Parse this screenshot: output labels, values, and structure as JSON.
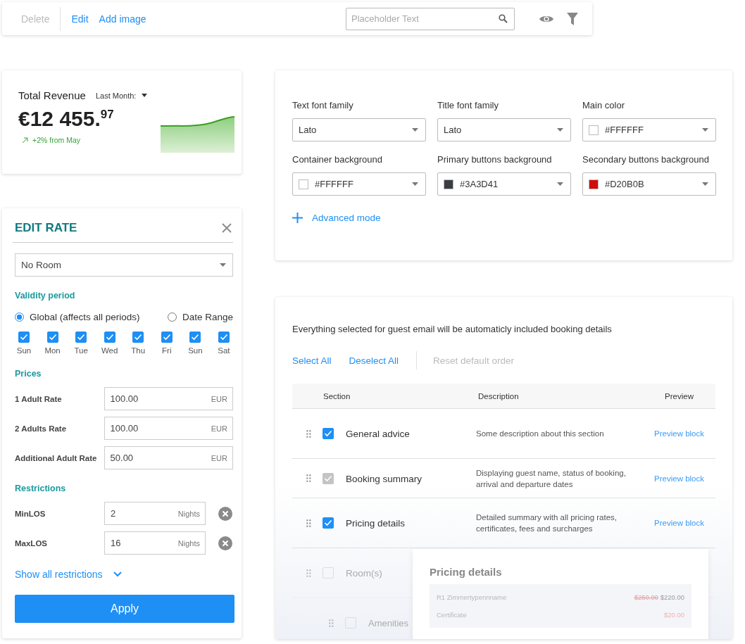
{
  "toolbar": {
    "actions": [
      {
        "label": "Delete",
        "disabled": true
      },
      {
        "label": "Edit",
        "disabled": false
      },
      {
        "label": "Add image",
        "disabled": false
      }
    ],
    "search": {
      "placeholder": "Placeholder Text"
    }
  },
  "revenue": {
    "title": "Total Revenue",
    "period": "Last Month:",
    "amount": "€12 455.$^{97}$",
    "change": "+2% from May"
  },
  "edit_rate": {
    "title": "EDIT RATE",
    "room": "No Room",
    "validity_heading": "Validity period",
    "validity_options": [
      {
        "label": "Global (affects all periods)",
        "selected": true
      },
      {
        "label": "Date Range",
        "selected": false
      }
    ],
    "days": [
      {
        "label": "Sun",
        "checked": true
      },
      {
        "label": "Mon",
        "checked": true
      },
      {
        "label": "Tue",
        "checked": true
      },
      {
        "label": "Wed",
        "checked": true
      },
      {
        "label": "Thu",
        "checked": true
      },
      {
        "label": "Fri",
        "checked": true
      },
      {
        "label": "Sun",
        "checked": true
      },
      {
        "label": "Sat",
        "checked": true
      }
    ],
    "prices_heading": "Prices",
    "prices": [
      {
        "label": "1 Adult Rate",
        "value": "100.00",
        "unit": "EUR"
      },
      {
        "label": "2 Adults Rate",
        "value": "100.00",
        "unit": "EUR"
      },
      {
        "label": "Additional Adult Rate",
        "value": "50.00",
        "unit": "EUR"
      }
    ],
    "restrictions_heading": "Restrictions",
    "restrictions": [
      {
        "label": "MinLOS",
        "value": "2",
        "unit": "Nights"
      },
      {
        "label": "MaxLOS",
        "value": "16",
        "unit": "Nights"
      }
    ],
    "show_all": "Show all restrictions",
    "apply": "Apply"
  },
  "theme_settings": {
    "fields": [
      {
        "kind": "select",
        "label": "Text font family",
        "value": "Lato"
      },
      {
        "kind": "select",
        "label": "Title font family",
        "value": "Lato"
      },
      {
        "kind": "color",
        "label": "Main color",
        "value": "#FFFFFF",
        "color": "#ffffff"
      },
      {
        "kind": "color",
        "label": "Container background",
        "value": "#FFFFFF",
        "color": "#ffffff"
      },
      {
        "kind": "color",
        "label": "Primary buttons background",
        "value": "#3A3D41",
        "color": "#3a3d41"
      },
      {
        "kind": "color",
        "label": "Secondary buttons background",
        "value": "#D20B0B",
        "color": "#d20b0b"
      }
    ],
    "advanced": "Advanced mode"
  },
  "email_sections": {
    "intro": "Everything selected for guest email will be automaticly included booking details",
    "actions": [
      {
        "label": "Select All",
        "disabled": false
      },
      {
        "label": "Deselect All",
        "disabled": false
      },
      {
        "label": "Reset default order",
        "disabled": true
      }
    ],
    "columns": [
      "Section",
      "Description",
      "Preview"
    ],
    "rows": [
      {
        "section": "General advice",
        "description": "Some description about this section",
        "preview": "Preview block",
        "checked": true,
        "disabled": false,
        "dimmed": false
      },
      {
        "section": "Booking summary",
        "description": "Displaying guest name, status of booking, arrival and departure dates",
        "preview": "Preview block",
        "checked": true,
        "disabled": true,
        "dimmed": false
      },
      {
        "section": "Pricing details",
        "description": "Detailed summary with all pricing rates, certificates, fees and surcharges",
        "preview": "Preview block",
        "checked": true,
        "disabled": false,
        "dimmed": false
      },
      {
        "section": "Room(s)",
        "checked": false,
        "disabled": false,
        "dimmed": true
      },
      {
        "section": "Amenities",
        "checked": false,
        "disabled": false,
        "dimmed": true
      }
    ],
    "popover": {
      "title": "Pricing details",
      "lines": [
        {
          "label": "R1 Zimmertypennname",
          "old_price": "$250.00",
          "price": "$220.00"
        },
        {
          "label": "Certificate",
          "price": "$20.00"
        }
      ]
    }
  }
}
